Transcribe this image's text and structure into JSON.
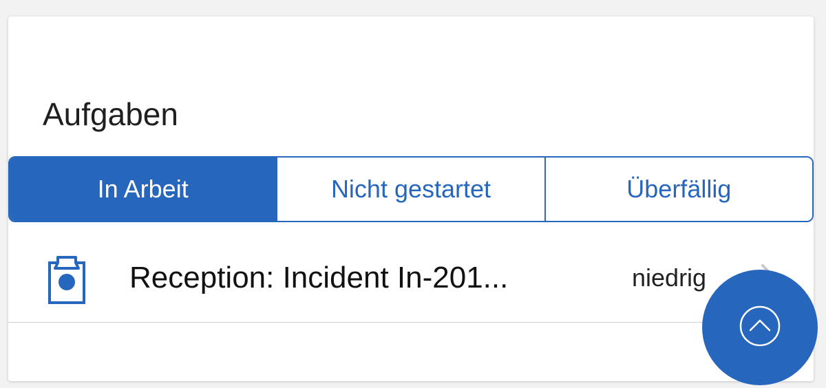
{
  "section": {
    "title": "Aufgaben"
  },
  "tabs": [
    {
      "label": "In Arbeit",
      "active": true
    },
    {
      "label": "Nicht gestartet",
      "active": false
    },
    {
      "label": "Überfällig",
      "active": false
    }
  ],
  "tasks": [
    {
      "title": "Reception: Incident In-201...",
      "priority": "niedrig",
      "icon": "clipboard-icon"
    }
  ],
  "fab": {
    "icon": "chevron-up-circle-icon"
  },
  "colors": {
    "accent": "#2667bd",
    "text": "#1f1f1f",
    "divider": "#cfcfcf"
  }
}
